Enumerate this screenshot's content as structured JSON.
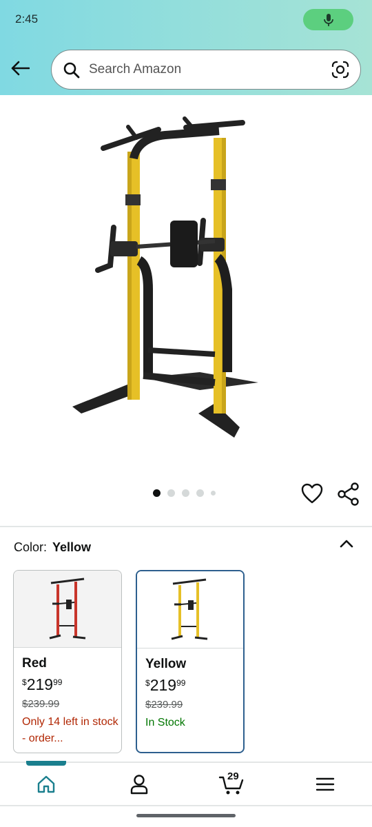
{
  "status_bar": {
    "time": "2:45"
  },
  "header": {
    "search": {
      "placeholder": "Search Amazon"
    }
  },
  "gallery": {
    "total_images": 5,
    "active_index": 0
  },
  "color_selector": {
    "label": "Color:",
    "selected": "Yellow",
    "options": [
      {
        "name": "Red",
        "price_symbol": "$",
        "price_whole": "219",
        "price_fraction": "99",
        "list_price": "$239.99",
        "stock": "Only 14 left in stock - order...",
        "frame_color": "#c8352b"
      },
      {
        "name": "Yellow",
        "price_symbol": "$",
        "price_whole": "219",
        "price_fraction": "99",
        "list_price": "$239.99",
        "stock": "In Stock",
        "frame_color": "#e6c027"
      }
    ]
  },
  "bottom_nav": {
    "cart_count": "29",
    "items": [
      "home-icon",
      "account-icon",
      "cart-icon",
      "menu-icon"
    ]
  },
  "colors": {
    "header_gradient_start": "#80d9e2",
    "header_gradient_end": "#a6e3d5",
    "mic_pill": "#5ccf7f",
    "selected_border": "#2d5f8e",
    "nav_active": "#1a7f8e",
    "stock_red": "#b12704",
    "stock_green": "#007600"
  }
}
